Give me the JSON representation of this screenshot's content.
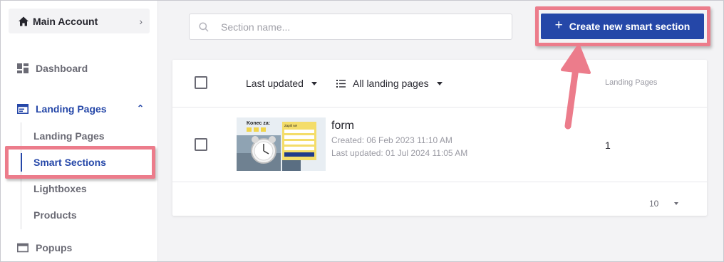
{
  "sidebar": {
    "account_label": "Main Account",
    "items": [
      {
        "label": "Dashboard"
      },
      {
        "label": "Landing Pages"
      },
      {
        "label": "Popups"
      }
    ],
    "sub_items": [
      {
        "label": "Landing Pages"
      },
      {
        "label": "Smart Sections"
      },
      {
        "label": "Lightboxes"
      },
      {
        "label": "Products"
      }
    ]
  },
  "search": {
    "placeholder": "Section name..."
  },
  "toolbar": {
    "create_label": "Create new smart section"
  },
  "table": {
    "sort_label": "Last updated",
    "filter_label": "All landing pages",
    "col_landing_pages": "Landing Pages",
    "rows": [
      {
        "title": "form",
        "created": "Created: 06 Feb 2023 11:10 AM",
        "updated": "Last updated: 01 Jul 2024 11:05 AM",
        "landing_pages": "1",
        "thumb_heading": "Konec za:",
        "thumb_form_title": "Zapiš se!"
      }
    ],
    "per_page": "10"
  },
  "colors": {
    "accent": "#2547a8",
    "highlight": "#ec7c8b"
  },
  "icons": [
    "home-icon",
    "chevron-right-icon",
    "dashboard-icon",
    "landing-pages-icon",
    "chevron-up-icon",
    "popups-icon",
    "search-icon",
    "plus-icon",
    "list-icon",
    "caret-down-icon",
    "annotation-arrow"
  ]
}
